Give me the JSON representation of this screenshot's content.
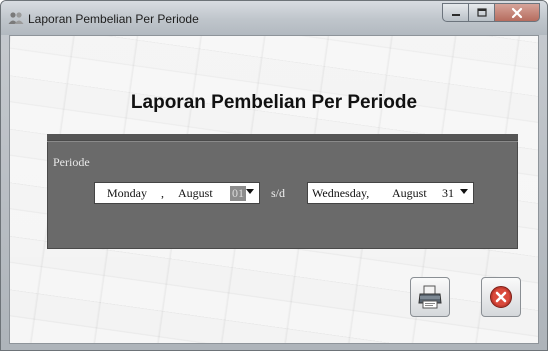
{
  "window": {
    "title": "Laporan Pembelian Per Periode",
    "app_icon": "group-users-icon",
    "controls": [
      "minimize-icon",
      "maximize-icon",
      "close-icon"
    ]
  },
  "main": {
    "heading": "Laporan Pembelian Per Periode",
    "panel": {
      "label": "Periode",
      "date_from": {
        "weekday": "Monday",
        "sep": ",",
        "month": "August",
        "day": "01"
      },
      "range_sep": "s/d",
      "date_to": {
        "weekday": "Wednesday,",
        "month": "August",
        "day": "31"
      }
    },
    "buttons": {
      "print_icon": "printer-icon",
      "close_icon": "close-circle-icon"
    }
  },
  "colors": {
    "panel_bg": "#6a6a6a",
    "close_button_red": "#c23b2f"
  }
}
